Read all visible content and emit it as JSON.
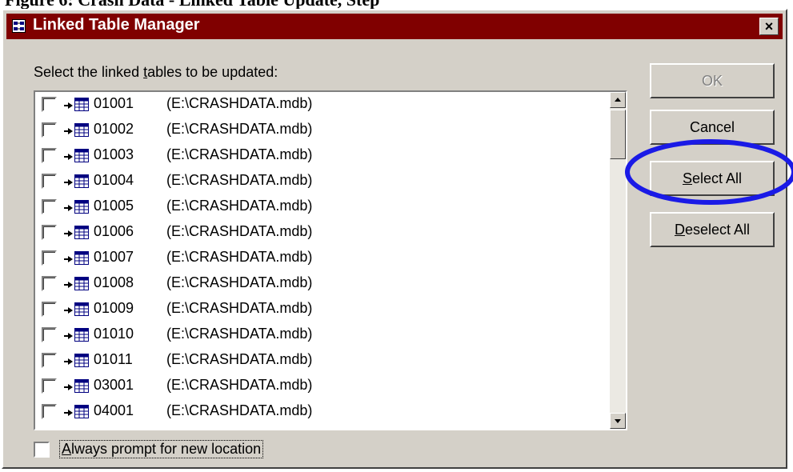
{
  "document_caption": "Figure 6: Crash Data - Linked Table Update, Step",
  "dialog": {
    "title": "Linked Table Manager",
    "close_label": "×"
  },
  "prompt": {
    "before": "Select the linked ",
    "accel": "t",
    "after": "ables to be updated:"
  },
  "tables": [
    {
      "name": "01001",
      "path": "(E:\\CRASHDATA.mdb)",
      "checked": false
    },
    {
      "name": "01002",
      "path": "(E:\\CRASHDATA.mdb)",
      "checked": false
    },
    {
      "name": "01003",
      "path": "(E:\\CRASHDATA.mdb)",
      "checked": false
    },
    {
      "name": "01004",
      "path": "(E:\\CRASHDATA.mdb)",
      "checked": false
    },
    {
      "name": "01005",
      "path": "(E:\\CRASHDATA.mdb)",
      "checked": false
    },
    {
      "name": "01006",
      "path": "(E:\\CRASHDATA.mdb)",
      "checked": false
    },
    {
      "name": "01007",
      "path": "(E:\\CRASHDATA.mdb)",
      "checked": false
    },
    {
      "name": "01008",
      "path": "(E:\\CRASHDATA.mdb)",
      "checked": false
    },
    {
      "name": "01009",
      "path": "(E:\\CRASHDATA.mdb)",
      "checked": false
    },
    {
      "name": "01010",
      "path": "(E:\\CRASHDATA.mdb)",
      "checked": false
    },
    {
      "name": "01011",
      "path": "(E:\\CRASHDATA.mdb)",
      "checked": false
    },
    {
      "name": "03001",
      "path": "(E:\\CRASHDATA.mdb)",
      "checked": false
    },
    {
      "name": "04001",
      "path": "(E:\\CRASHDATA.mdb)",
      "checked": false
    }
  ],
  "buttons": {
    "ok": {
      "label": "OK",
      "enabled": false
    },
    "cancel": {
      "label": "Cancel"
    },
    "select_all": {
      "accel": "S",
      "rest": "elect All"
    },
    "deselect_all": {
      "accel": "D",
      "rest": "eselect All"
    }
  },
  "always_prompt": {
    "accel": "A",
    "rest": "lways prompt for new location",
    "checked": false
  },
  "colors": {
    "titlebar": "#800000",
    "dialog_bg": "#d4d0c8",
    "highlight_ellipse": "#1a1ae6"
  },
  "icons": {
    "title": "linked-table-manager-icon",
    "row_link": "link-arrow-icon",
    "row_table": "table-grid-icon"
  }
}
